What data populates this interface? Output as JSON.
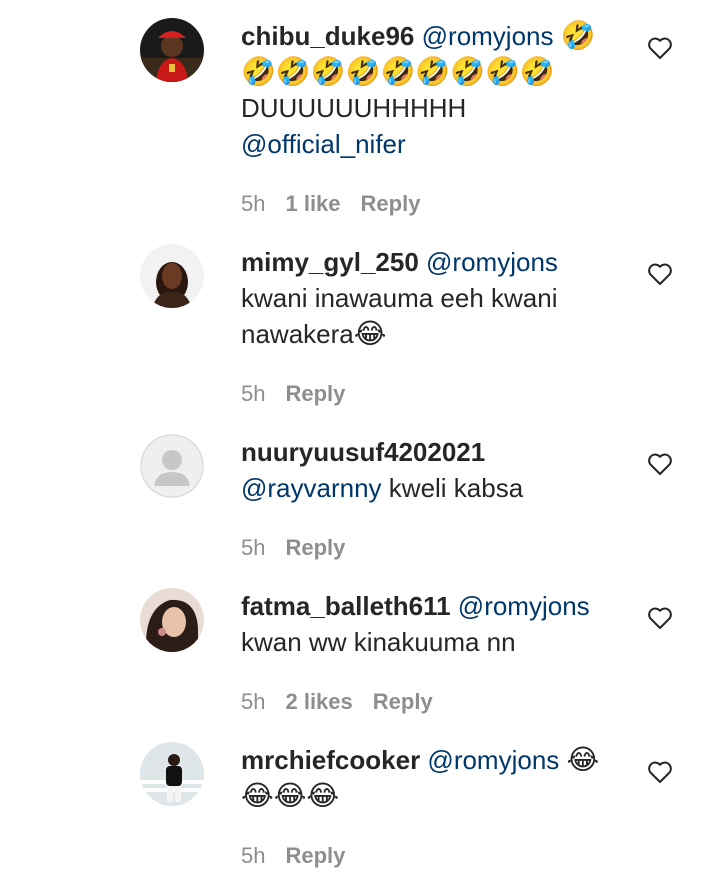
{
  "comments": [
    {
      "username": "chibu_duke96",
      "mention": "@romyjons",
      "emoji_after_mention": "🤣",
      "line2": "🤣🤣🤣🤣🤣🤣🤣🤣🤣",
      "line3": "DUUUUUUHHHHH",
      "line4": "@official_nifer",
      "time": "5h",
      "likes": "1 like",
      "reply": "Reply"
    },
    {
      "username": "mimy_gyl_250",
      "mention": "@romyjons",
      "text": "kwani inawauma eeh kwani nawakera",
      "emoji": "😂",
      "time": "5h",
      "reply": "Reply"
    },
    {
      "username": "nuuryuusuf4202021",
      "mention": "@rayvarnny",
      "text": "kweli kabsa",
      "time": "5h",
      "reply": "Reply"
    },
    {
      "username": "fatma_balleth611",
      "mention": "@romyjons",
      "text": "kwan ww kinakuuma nn",
      "time": "5h",
      "likes": "2 likes",
      "reply": "Reply"
    },
    {
      "username": "mrchiefcooker",
      "mention": "@romyjons",
      "emoji_after_mention": "😂",
      "line2": "😂😂😂",
      "time": "5h",
      "reply": "Reply"
    }
  ],
  "colors": {
    "username": "#262626",
    "mention": "#00376b",
    "meta": "#8e8e8e",
    "heart": "#262626"
  },
  "icons": {
    "like": "heart-outline-icon",
    "avatar_placeholder": "default-user-avatar-icon"
  }
}
